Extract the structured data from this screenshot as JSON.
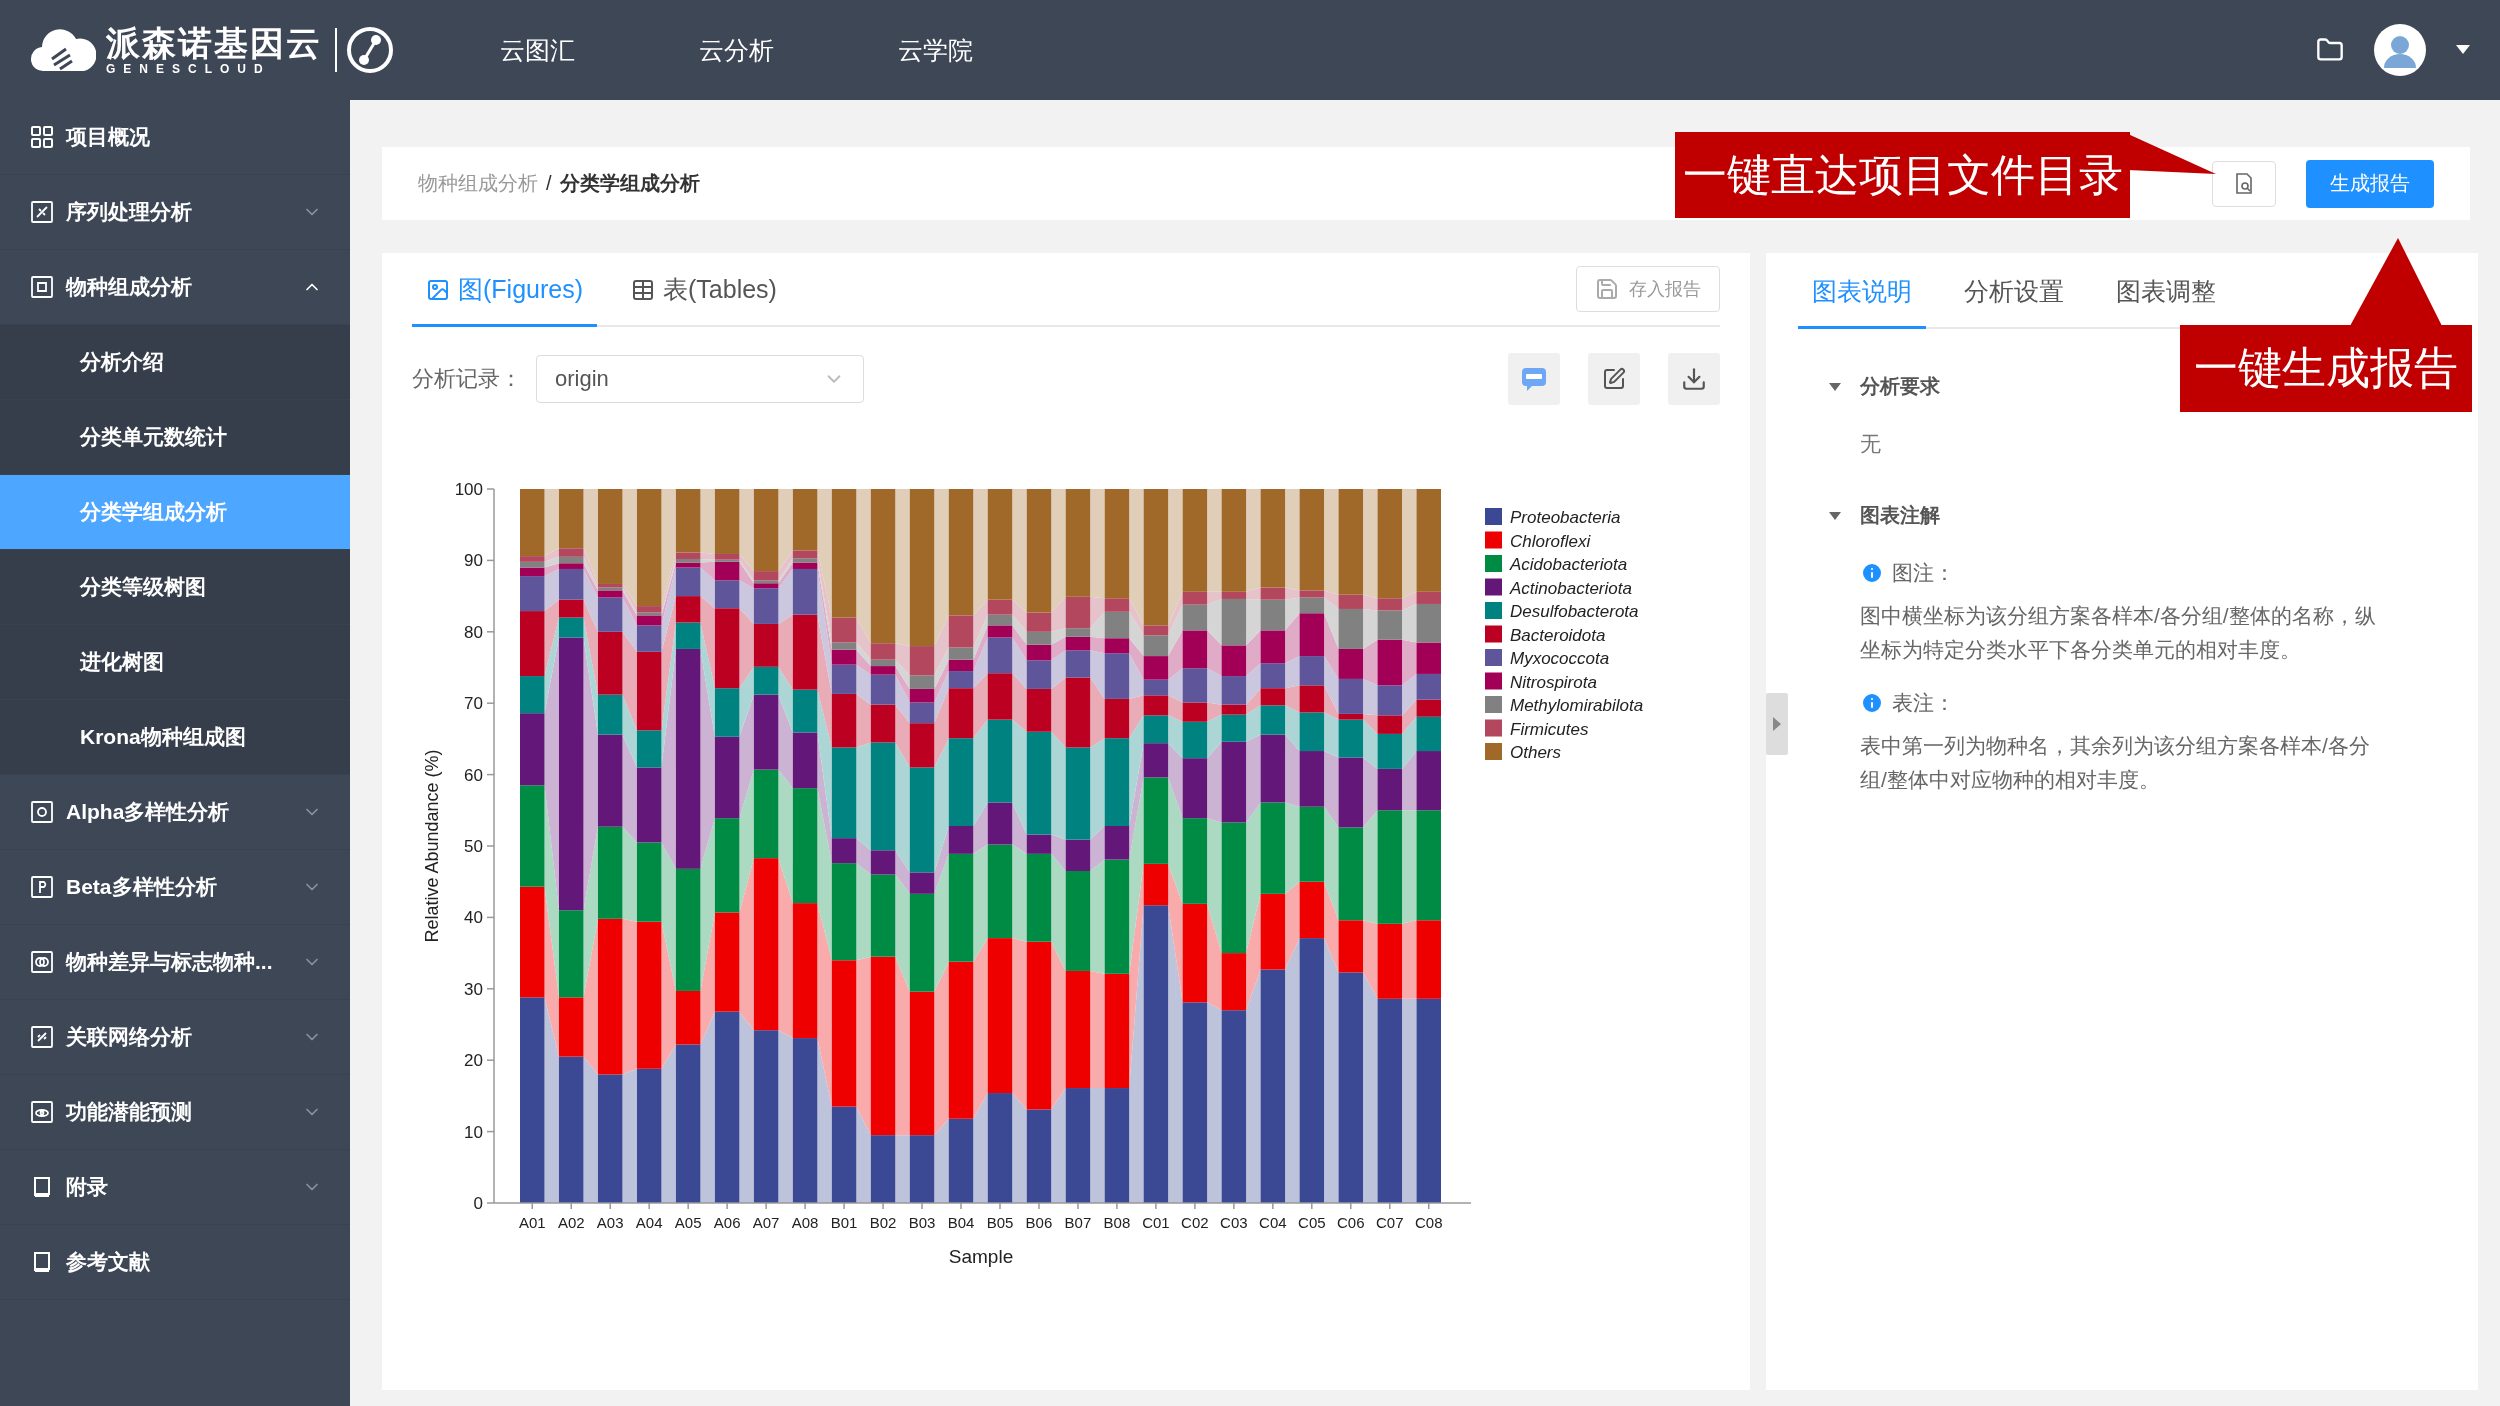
{
  "header": {
    "logo_text": "派森诺基因云",
    "logo_subtext": "GENESCLOUD",
    "nav": [
      {
        "label": "云图汇"
      },
      {
        "label": "云分析"
      },
      {
        "label": "云学院"
      }
    ]
  },
  "sidebar": {
    "items": [
      {
        "label": "项目概况"
      },
      {
        "label": "序列处理分析",
        "expanded": false
      },
      {
        "label": "物种组成分析",
        "expanded": true,
        "children": [
          {
            "label": "分析介绍",
            "selected": false
          },
          {
            "label": "分类单元数统计",
            "selected": false
          },
          {
            "label": "分类学组成分析",
            "selected": true
          },
          {
            "label": "分类等级树图",
            "selected": false
          },
          {
            "label": "进化树图",
            "selected": false
          },
          {
            "label": "Krona物种组成图",
            "selected": false
          }
        ]
      },
      {
        "label": "Alpha多样性分析",
        "expanded": false
      },
      {
        "label": "Beta多样性分析",
        "expanded": false
      },
      {
        "label": "物种差异与标志物种...",
        "expanded": false
      },
      {
        "label": "关联网络分析",
        "expanded": false
      },
      {
        "label": "功能潜能预测",
        "expanded": false
      },
      {
        "label": "附录",
        "expanded": false
      },
      {
        "label": "参考文献"
      }
    ]
  },
  "breadcrumb": {
    "parent": "物种组成分析",
    "separator": "/",
    "current": "分类学组成分析"
  },
  "report_button": "生成报告",
  "figure_panel": {
    "tabs": [
      {
        "label": "图(Figures)",
        "selected": true
      },
      {
        "label": "表(Tables)",
        "selected": false
      }
    ],
    "save_button": {
      "label": "存入报告",
      "disabled": true
    },
    "record_label": "分析记录：",
    "record_value": "origin",
    "chart_data": {
      "type": "bar",
      "stacked": true,
      "legend": "right",
      "xlabel": "Sample",
      "ylabel": "Relative Abundance (%)",
      "ylim": [
        0,
        100
      ],
      "yticks": [
        0,
        10,
        20,
        30,
        40,
        50,
        60,
        70,
        80,
        90,
        100
      ],
      "categories": [
        "A01",
        "A02",
        "A03",
        "A04",
        "A05",
        "A06",
        "A07",
        "A08",
        "B01",
        "B02",
        "B03",
        "B04",
        "B05",
        "B06",
        "B07",
        "B08",
        "C01",
        "C02",
        "C03",
        "C04",
        "C05",
        "C06",
        "C07",
        "C08"
      ],
      "series": [
        {
          "name": "Proteobacteria",
          "color": "#3b4994",
          "values": [
            28.8,
            20.5,
            18,
            18.8,
            22.2,
            26.8,
            24.2,
            23.1,
            13.5,
            9.5,
            9.5,
            11.8,
            15.4,
            13.1,
            16.1,
            16.1,
            41.7,
            28.1,
            27,
            32.7,
            37.1,
            32.3,
            28.6,
            28.6
          ]
        },
        {
          "name": "Chloroflexi",
          "color": "#ee0000",
          "values": [
            15.5,
            8.3,
            21.8,
            20.6,
            7.5,
            13.9,
            24.1,
            18.9,
            20.5,
            25,
            20.1,
            22,
            21.7,
            23.5,
            16.4,
            16,
            5.8,
            13.8,
            8,
            10.6,
            7.9,
            7.3,
            10.5,
            11
          ]
        },
        {
          "name": "Acidobacteriota",
          "color": "#008b45",
          "values": [
            14.2,
            12.2,
            12.9,
            11.1,
            17.1,
            13.2,
            12.4,
            16.1,
            13.6,
            11.5,
            13.7,
            15.1,
            13.1,
            12.3,
            14,
            16,
            12.1,
            12,
            18.3,
            12.8,
            10.5,
            13,
            15.9,
            15.4
          ]
        },
        {
          "name": "Actinobacteriota",
          "color": "#631879",
          "values": [
            10.1,
            38.2,
            12.9,
            10.5,
            30.8,
            11.4,
            10.5,
            7.8,
            3.5,
            3.4,
            3,
            3.9,
            5.9,
            2.7,
            4.4,
            4.7,
            4.8,
            8.4,
            11.3,
            9.5,
            7.8,
            9.8,
            5.8,
            8.3
          ]
        },
        {
          "name": "Desulfobacterota",
          "color": "#008280",
          "values": [
            5.2,
            2.8,
            5.6,
            5.2,
            3.7,
            6.8,
            3.9,
            6,
            12.7,
            15.1,
            14.7,
            12.3,
            11.6,
            14.4,
            12.9,
            12.3,
            3.9,
            5.1,
            3.8,
            4.1,
            5.4,
            5.3,
            4.9,
            4.8
          ]
        },
        {
          "name": "Bacteroidota",
          "color": "#bb0021",
          "values": [
            9.1,
            2.5,
            8.8,
            11,
            3.7,
            11.2,
            6,
            10.5,
            7.5,
            5.3,
            6.2,
            7,
            6.5,
            6,
            9.8,
            5.5,
            2.8,
            2.7,
            1.4,
            2.4,
            3.8,
            0.8,
            2.6,
            2.4
          ]
        },
        {
          "name": "Myxococcota",
          "color": "#5f559b",
          "values": [
            4.9,
            4.3,
            4.8,
            3.7,
            4,
            3.9,
            5,
            6.4,
            4.1,
            4.2,
            2.9,
            2.4,
            5,
            4,
            3.8,
            6.4,
            2.2,
            4.8,
            4,
            3.5,
            4.1,
            4.9,
            4.2,
            3.6
          ]
        },
        {
          "name": "Nitrospirota",
          "color": "#a20056",
          "values": [
            1.2,
            0.8,
            1,
            1.4,
            0.7,
            2.6,
            0.7,
            0.9,
            2.1,
            1.2,
            1.9,
            1.6,
            1.7,
            2.2,
            1.9,
            2.1,
            3.3,
            5.3,
            4.3,
            4.6,
            6,
            4.2,
            6.4,
            4.4
          ]
        },
        {
          "name": "Methylomirabilota",
          "color": "#808180",
          "values": [
            0.8,
            0.9,
            0.4,
            0.4,
            0.5,
            0.3,
            0.4,
            0.6,
            1,
            0.9,
            1.9,
            1.7,
            1.5,
            1.8,
            1.2,
            3.7,
            2.9,
            3.6,
            6.5,
            4.3,
            2.2,
            5.6,
            4.1,
            5.4
          ]
        },
        {
          "name": "Firmicutes",
          "color": "#b2475d",
          "values": [
            0.8,
            1.2,
            0.5,
            0.9,
            0.9,
            0.8,
            1.3,
            1.1,
            3.5,
            2.3,
            4.1,
            4.5,
            2.1,
            2.7,
            4.4,
            1.9,
            1.4,
            1.8,
            1,
            1.7,
            1,
            2,
            1.7,
            1.7
          ]
        },
        {
          "name": "Others",
          "color": "#a0692a",
          "values": [
            9.4,
            8.3,
            13.3,
            16.4,
            8.9,
            9.1,
            11.5,
            8.6,
            18,
            21.6,
            22,
            17.7,
            15.5,
            17.3,
            15.1,
            15.3,
            19.1,
            14.4,
            14.4,
            13.8,
            14.2,
            14.8,
            15.3,
            14.4
          ]
        }
      ]
    }
  },
  "info_panel": {
    "tabs": [
      {
        "label": "图表说明",
        "selected": true
      },
      {
        "label": "分析设置",
        "selected": false
      },
      {
        "label": "图表调整",
        "selected": false
      }
    ],
    "sections": [
      {
        "title": "分析要求",
        "expanded": true,
        "notes": [
          {
            "kind": "plain",
            "text": "无"
          }
        ]
      },
      {
        "title": "图表注解",
        "expanded": true,
        "notes": [
          {
            "kind": "info",
            "title": "图注：",
            "text": "图中横坐标为该分组方案各样本/各分组/整体的名称，纵坐标为特定分类水平下各分类单元的相对丰度。"
          },
          {
            "kind": "info",
            "title": "表注：",
            "text": "表中第一列为物种名，其余列为该分组方案各样本/各分组/整体中对应物种的相对丰度。"
          }
        ]
      }
    ]
  },
  "callouts": [
    {
      "kind": "left",
      "text": "一键直达项目文件目录"
    },
    {
      "kind": "up",
      "text": "一键生成报告"
    }
  ]
}
